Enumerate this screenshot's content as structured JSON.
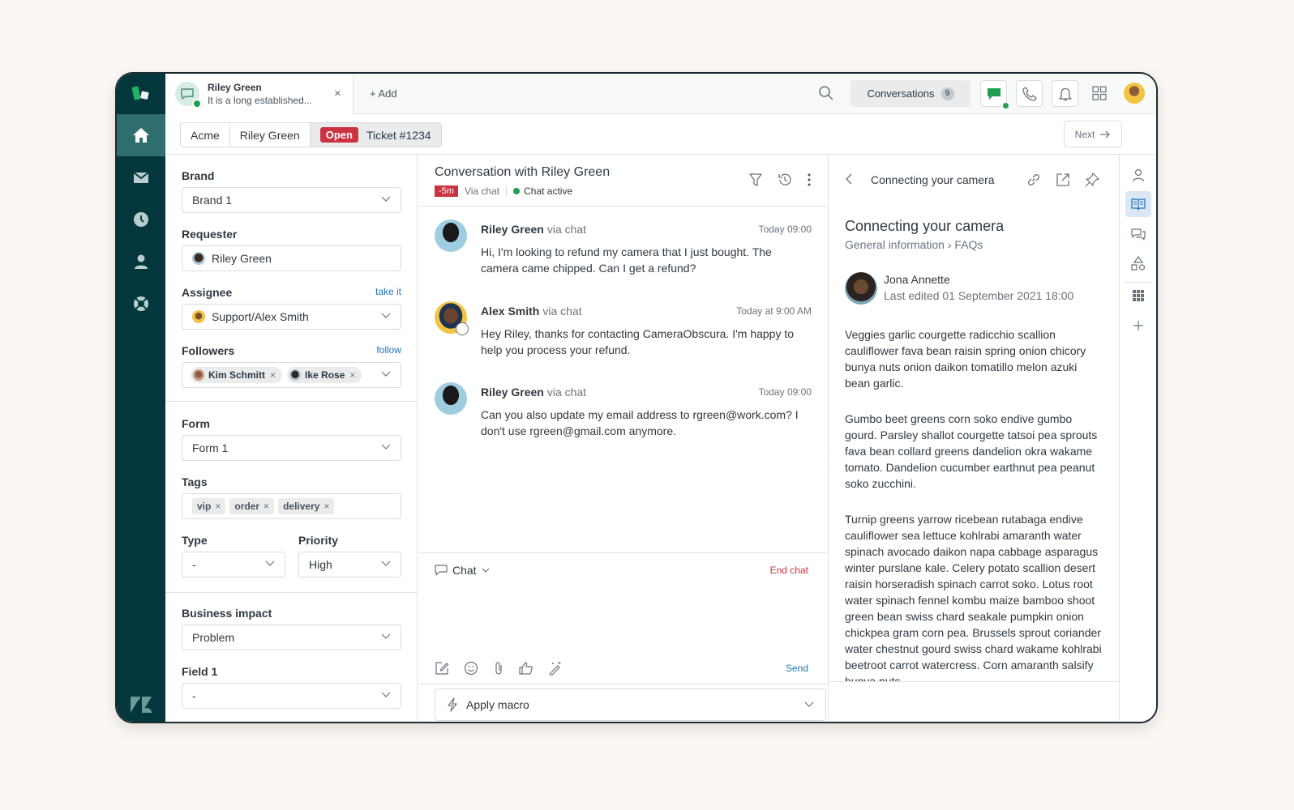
{
  "topbar": {
    "tab": {
      "name": "Riley Green",
      "preview": "It is a long established...",
      "close": "×"
    },
    "add_tab": "+ Add",
    "conversations": {
      "label": "Conversations",
      "count": "9"
    }
  },
  "breadcrumb": {
    "org": "Acme",
    "requester": "Riley Green",
    "status": "Open",
    "ticket": "Ticket #1234",
    "status_color": "#cc3340"
  },
  "next_button": "Next",
  "props": {
    "brand": {
      "label": "Brand",
      "value": "Brand 1"
    },
    "requester": {
      "label": "Requester",
      "value": "Riley Green"
    },
    "assignee": {
      "label": "Assignee",
      "value": "Support/Alex Smith",
      "action": "take it"
    },
    "followers": {
      "label": "Followers",
      "action": "follow",
      "items": [
        "Kim Schmitt",
        "Ike Rose"
      ]
    },
    "form": {
      "label": "Form",
      "value": "Form 1"
    },
    "tags": {
      "label": "Tags",
      "items": [
        "vip",
        "order",
        "delivery"
      ]
    },
    "type": {
      "label": "Type",
      "value": "-"
    },
    "priority": {
      "label": "Priority",
      "value": "High"
    },
    "business_impact": {
      "label": "Business impact",
      "value": "Problem"
    },
    "field1": {
      "label": "Field 1",
      "value": "-"
    }
  },
  "conversation": {
    "title": "Conversation with Riley Green",
    "sla": "-5m",
    "channel": "Via chat",
    "status": "Chat active",
    "messages": [
      {
        "author": "Riley Green",
        "via": "via chat",
        "time": "Today 09:00",
        "body": "Hi, I'm looking to refund my camera that I just bought. The camera came chipped. Can I get a refund?"
      },
      {
        "author": "Alex Smith",
        "via": "via chat",
        "time": "Today at 9:00 AM",
        "body": "Hey Riley, thanks for contacting CameraObscura. I'm happy to help you process your refund."
      },
      {
        "author": "Riley Green",
        "via": "via chat",
        "time": "Today 09:00",
        "body": "Can you also update my email address to rgreen@work.com? I don't use rgreen@gmail.com anymore."
      }
    ],
    "composer": {
      "channel": "Chat",
      "end_chat": "End chat",
      "send": "Send"
    },
    "macro": "Apply macro"
  },
  "knowledge": {
    "header_title": "Connecting your camera",
    "title": "Connecting your camera",
    "crumb_1": "General information",
    "crumb_2": "FAQs",
    "author": "Jona Annette",
    "edited": "Last edited 01 September 2021 18:00",
    "paragraphs": [
      "Veggies garlic courgette radicchio scallion cauliflower fava bean raisin spring onion chicory bunya nuts onion daikon tomatillo melon azuki bean garlic.",
      "Gumbo beet greens corn soko endive gumbo gourd. Parsley shallot courgette tatsoi pea sprouts fava bean collard greens dandelion okra wakame tomato. Dandelion cucumber earthnut pea peanut soko zucchini.",
      "Turnip greens yarrow ricebean rutabaga endive cauliflower sea lettuce kohlrabi amaranth water spinach avocado daikon napa cabbage asparagus winter purslane kale. Celery potato scallion desert raisin horseradish spinach carrot soko. Lotus root water spinach fennel kombu maize bamboo shoot green bean swiss chard seakale pumpkin onion chickpea gram corn pea. Brussels sprout coriander water chestnut gourd swiss chard wakame kohlrabi beetroot carrot watercress. Corn amaranth salsify bunya nuts"
    ]
  },
  "colors": {
    "nav_bg": "#03363d",
    "accent_green": "#1f9f4f",
    "danger": "#cc3340",
    "link": "#1f73b7"
  }
}
